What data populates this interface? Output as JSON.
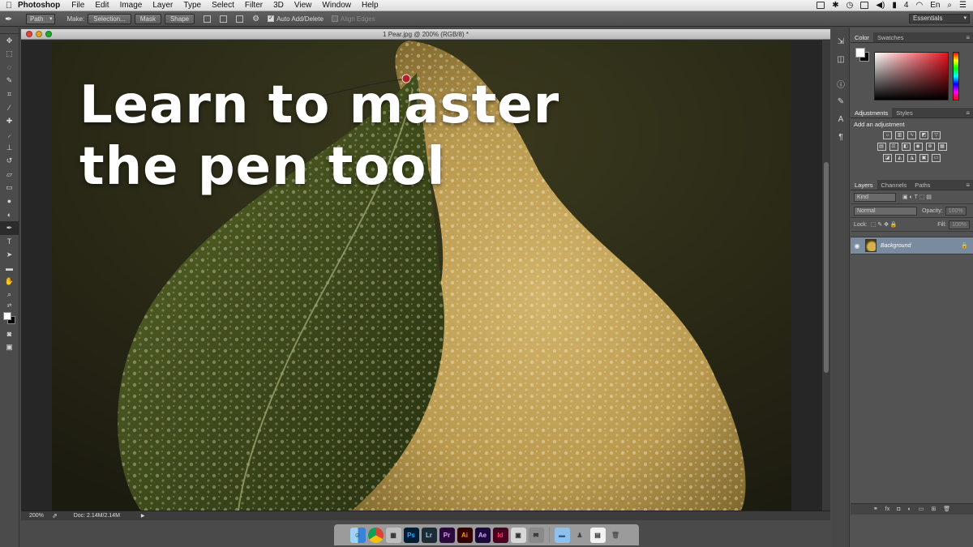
{
  "menubar": {
    "app_name": "Photoshop",
    "menus": [
      "File",
      "Edit",
      "Image",
      "Layer",
      "Type",
      "Select",
      "Filter",
      "3D",
      "View",
      "Window",
      "Help"
    ],
    "battery_label": "4",
    "input_source": "En"
  },
  "options_bar": {
    "mode": "Path",
    "make_label": "Make:",
    "selection_button": "Selection...",
    "mask_button": "Mask",
    "shape_button": "Shape",
    "auto_add_delete": "Auto Add/Delete",
    "align_edges": "Align Edges",
    "workspace": "Essentials"
  },
  "document": {
    "title": "1 Pear.jpg @ 200% (RGB/8) *",
    "zoom": "200%",
    "doc_size": "Doc: 2.14M/2.14M"
  },
  "headline": {
    "line1": "Learn to master",
    "line2": "the pen tool"
  },
  "color_panel": {
    "tabs": [
      "Color",
      "Swatches"
    ]
  },
  "adjustments_panel": {
    "tabs": [
      "Adjustments",
      "Styles"
    ],
    "heading": "Add an adjustment"
  },
  "layers_panel": {
    "tabs": [
      "Layers",
      "Channels",
      "Paths"
    ],
    "filter": "Kind",
    "blend_mode": "Normal",
    "opacity_label": "Opacity:",
    "opacity_value": "100%",
    "lock_label": "Lock:",
    "fill_label": "Fill:",
    "fill_value": "100%",
    "layer_name": "Background"
  },
  "dock_apps": [
    "Finder",
    "Chrome",
    "Preview",
    "Ps",
    "Lr",
    "Pr",
    "Ai",
    "Ae",
    "Id",
    "Screenshot",
    "Mail",
    "Folder",
    "Automator",
    "Notes",
    "Trash"
  ],
  "colors": {
    "accent_layer": "#7a8ba0",
    "ui_dark": "#535353"
  }
}
